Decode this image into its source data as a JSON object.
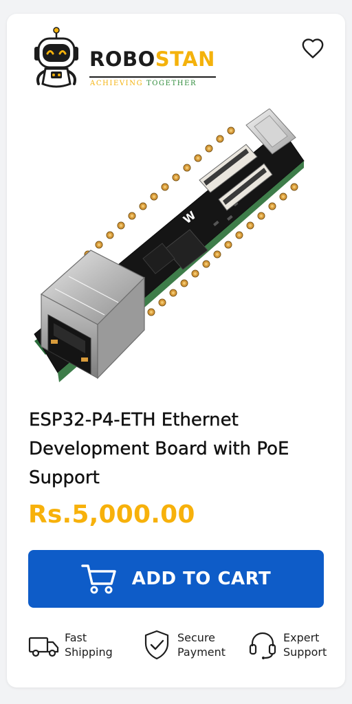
{
  "brand": {
    "name_part1": "ROBO",
    "name_part2": "STAN",
    "tagline_part1": "ACHIEVING ",
    "tagline_part2": "TOGETHER",
    "logo_icon": "robot-mascot-icon",
    "colors": {
      "dark": "#1c1c1c",
      "accent": "#f4b20c",
      "green": "#2e8b3a"
    }
  },
  "wishlist": {
    "icon": "heart-outline-icon"
  },
  "product": {
    "image_icon": "circuit-board-image",
    "title": "ESP32-P4-ETH Ethernet Development Board with PoE Support",
    "price": "Rs.5,000.00",
    "price_color": "#f7b10b"
  },
  "cta": {
    "label": "ADD TO CART",
    "icon": "shopping-cart-icon",
    "color": "#0e5cc8"
  },
  "features": [
    {
      "line1": "Fast",
      "line2": "Shipping",
      "icon": "truck-icon"
    },
    {
      "line1": "Secure",
      "line2": "Payment",
      "icon": "shield-check-icon"
    },
    {
      "line1": "Expert",
      "line2": "Support",
      "icon": "headset-icon"
    }
  ]
}
